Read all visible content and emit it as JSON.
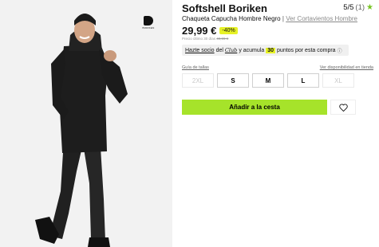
{
  "product": {
    "brand_logo_text": "BORIKEN",
    "title": "Softshell Boriken",
    "rating": {
      "score": "5/5",
      "count": "(1)"
    },
    "subtitle": "Chaqueta Capucha Hombre Negro",
    "separator": "|",
    "variants_link": "Ver Cortavientos Hombre",
    "price": "29,99 €",
    "discount": "-40%",
    "previous_price_label": "Precio último 30 días",
    "previous_price": "49,99 €"
  },
  "club": {
    "join_link": "Hazte socio",
    "text_a": "del",
    "logo_text": "Club",
    "text_b": "y acumula",
    "points": "30",
    "text_c": "puntos por esta compra"
  },
  "sizes": {
    "guide_link": "Guía de tallas",
    "availability_link": "Ver disponibilidad en tienda",
    "options": [
      {
        "label": "2XL",
        "available": false
      },
      {
        "label": "S",
        "available": true
      },
      {
        "label": "M",
        "available": true
      },
      {
        "label": "L",
        "available": true
      },
      {
        "label": "XL",
        "available": false
      }
    ]
  },
  "actions": {
    "add_to_cart": "Añadir a la cesta"
  },
  "colors": {
    "accent_green": "#a6e32a",
    "highlight_yellow": "#e7f227",
    "star": "#78c424"
  },
  "icons": {
    "rating": "star-icon",
    "wishlist": "heart-icon",
    "info": "info-icon"
  }
}
